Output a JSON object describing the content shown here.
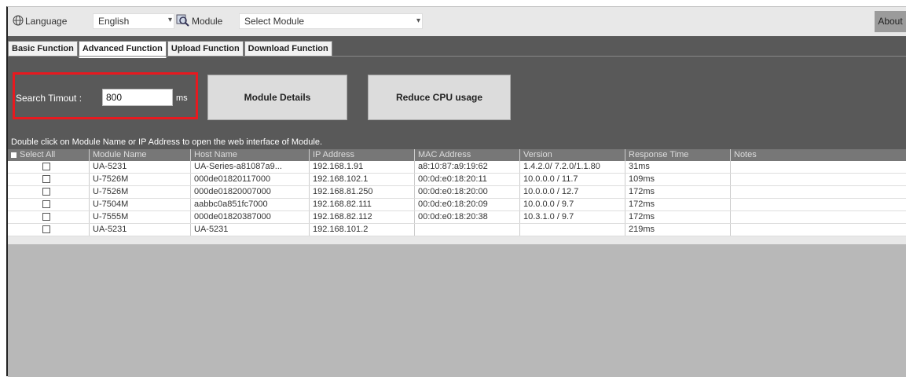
{
  "topbar": {
    "language_label": "Language",
    "language_value": "English",
    "module_label": "Module",
    "module_value": "Select Module",
    "about_label": "About"
  },
  "tabs": [
    {
      "label": "Basic Function",
      "active": false
    },
    {
      "label": "Advanced Function",
      "active": true
    },
    {
      "label": "Upload Function",
      "active": false
    },
    {
      "label": "Download Function",
      "active": false
    }
  ],
  "advanced": {
    "search_timeout_label": "Search Timout :",
    "search_timeout_value": "800",
    "unit": "ms",
    "module_details_button": "Module Details",
    "reduce_cpu_button": "Reduce CPU usage"
  },
  "info_text": "Double click on Module Name or IP Address to open the web interface of Module.",
  "table": {
    "headers": [
      "Select All",
      "Module Name",
      "Host Name",
      "IP Address",
      "MAC Address",
      "Version",
      "Response Time",
      "Notes"
    ],
    "rows": [
      [
        "",
        "UA-5231",
        "UA-Series-a81087a9...",
        "192.168.1.91",
        "a8:10:87:a9:19:62",
        "1.4.2.0/ 7.2.0/1.1.80",
        "31ms",
        ""
      ],
      [
        "",
        "U-7526M",
        "000de01820117000",
        "192.168.102.1",
        "00:0d:e0:18:20:11",
        "10.0.0.0 / 11.7",
        "109ms",
        ""
      ],
      [
        "",
        "U-7526M",
        "000de01820007000",
        "192.168.81.250",
        "00:0d:e0:18:20:00",
        "10.0.0.0 / 12.7",
        "172ms",
        ""
      ],
      [
        "",
        "U-7504M",
        "aabbc0a851fc7000",
        "192.168.82.111",
        "00:0d:e0:18:20:09",
        "10.0.0.0 / 9.7",
        "172ms",
        ""
      ],
      [
        "",
        "U-7555M",
        "000de01820387000",
        "192.168.82.112",
        "00:0d:e0:18:20:38",
        "10.3.1.0 / 9.7",
        "172ms",
        ""
      ],
      [
        "",
        "UA-5231",
        "UA-5231",
        "192.168.101.2",
        "",
        "",
        "219ms",
        ""
      ]
    ]
  },
  "colors": {
    "panel_dark": "#595959",
    "highlight_red": "#e8191f",
    "table_header": "#777777",
    "empty_area": "#b8b8b8"
  }
}
